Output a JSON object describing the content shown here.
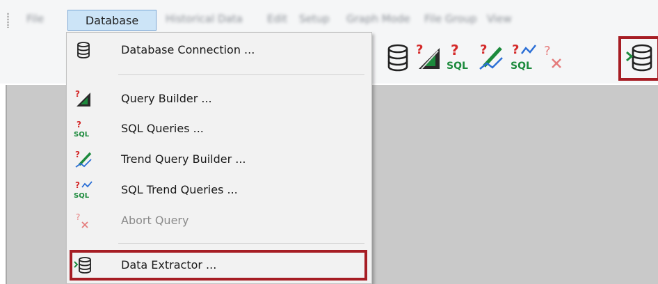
{
  "menubar": {
    "items": [
      {
        "label": "File"
      },
      {
        "label": "Database"
      },
      {
        "label": "Historical Data"
      },
      {
        "label": "Edit"
      },
      {
        "label": "Setup"
      },
      {
        "label": "Graph Mode"
      },
      {
        "label": "File Group"
      },
      {
        "label": "View"
      }
    ]
  },
  "toolbar": {
    "icons": [
      "database-icon",
      "query-builder-icon",
      "sql-queries-icon",
      "trend-query-builder-icon",
      "sql-trend-queries-icon",
      "abort-query-icon",
      "data-extractor-icon"
    ]
  },
  "dropdown": {
    "items": [
      {
        "label": "Database Connection ...",
        "icon": "database-icon",
        "enabled": true
      },
      {
        "label": "Query Builder ...",
        "icon": "query-builder-icon",
        "enabled": true
      },
      {
        "label": "SQL Queries ...",
        "icon": "sql-queries-icon",
        "enabled": true
      },
      {
        "label": "Trend Query Builder ...",
        "icon": "trend-query-builder-icon",
        "enabled": true
      },
      {
        "label": "SQL Trend Queries ...",
        "icon": "sql-trend-queries-icon",
        "enabled": true
      },
      {
        "label": "Abort Query",
        "icon": "abort-query-icon",
        "enabled": false
      },
      {
        "label": "Data Extractor ...",
        "icon": "data-extractor-icon",
        "enabled": true,
        "highlighted": true
      }
    ]
  },
  "colors": {
    "highlight": "#a61d24",
    "sql_green": "#1c8a3c",
    "question_red": "#d42a2a",
    "trend_blue": "#2b6fd6"
  }
}
